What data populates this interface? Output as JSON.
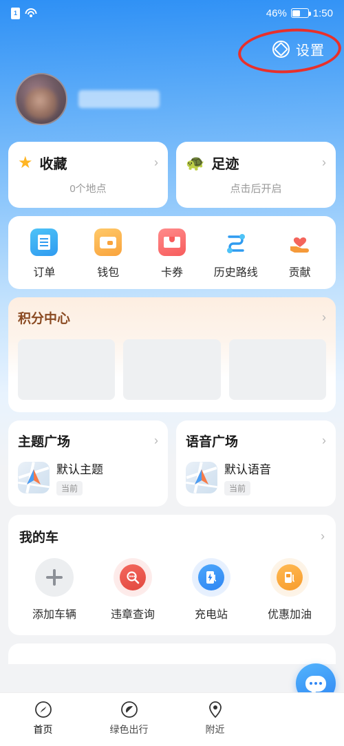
{
  "statusbar": {
    "sim_icon": "sim-card-icon",
    "sim_text": "1",
    "wifi_icon": "wifi-icon",
    "battery_percent": "46%",
    "battery_icon": "battery-icon",
    "time": "1:50"
  },
  "header": {
    "settings_label": "设置",
    "settings_icon": "gear-icon",
    "highlight_icon": "red-ellipse-annotation"
  },
  "profile": {
    "avatar_icon": "user-avatar",
    "name_redacted": ""
  },
  "shortcut_cards": [
    {
      "title": "收藏",
      "subtitle": "0个地点",
      "icon": "star-icon",
      "chevron": "chevron-right-icon"
    },
    {
      "title": "足迹",
      "subtitle": "点击后开启",
      "icon": "turtle-icon",
      "chevron": "chevron-right-icon"
    }
  ],
  "quick_actions": [
    {
      "label": "订单",
      "icon": "order-icon"
    },
    {
      "label": "钱包",
      "icon": "wallet-icon"
    },
    {
      "label": "卡券",
      "icon": "coupon-icon"
    },
    {
      "label": "历史路线",
      "icon": "route-history-icon"
    },
    {
      "label": "贡献",
      "icon": "contribution-icon"
    }
  ],
  "points_center": {
    "title": "积分中心",
    "chevron": "chevron-right-icon",
    "placeholders": 3
  },
  "plaza_cards": [
    {
      "title": "主题广场",
      "item_name": "默认主题",
      "badge": "当前",
      "thumb_icon": "map-theme-thumbnail",
      "chevron": "chevron-right-icon"
    },
    {
      "title": "语音广场",
      "item_name": "默认语音",
      "badge": "当前",
      "thumb_icon": "map-voice-thumbnail",
      "chevron": "chevron-right-icon"
    }
  ],
  "my_car": {
    "title": "我的车",
    "chevron": "chevron-right-icon",
    "items": [
      {
        "label": "添加车辆",
        "icon": "plus-icon"
      },
      {
        "label": "违章查询",
        "icon": "violation-search-icon"
      },
      {
        "label": "充电站",
        "icon": "charging-station-icon"
      },
      {
        "label": "优惠加油",
        "icon": "fuel-discount-icon"
      }
    ]
  },
  "chat_fab": {
    "icon": "chat-bubble-icon"
  },
  "tabbar": [
    {
      "label": "首页",
      "icon": "compass-icon",
      "active": true
    },
    {
      "label": "绿色出行",
      "icon": "leaf-icon",
      "active": false
    },
    {
      "label": "附近",
      "icon": "location-pin-icon",
      "active": false
    },
    {
      "label": "",
      "icon": "",
      "active": false
    }
  ],
  "colors": {
    "accent_blue": "#2f86f3",
    "annotation_red": "#e8302b",
    "star_yellow": "#ffb524",
    "points_brown": "#8a4a22"
  }
}
